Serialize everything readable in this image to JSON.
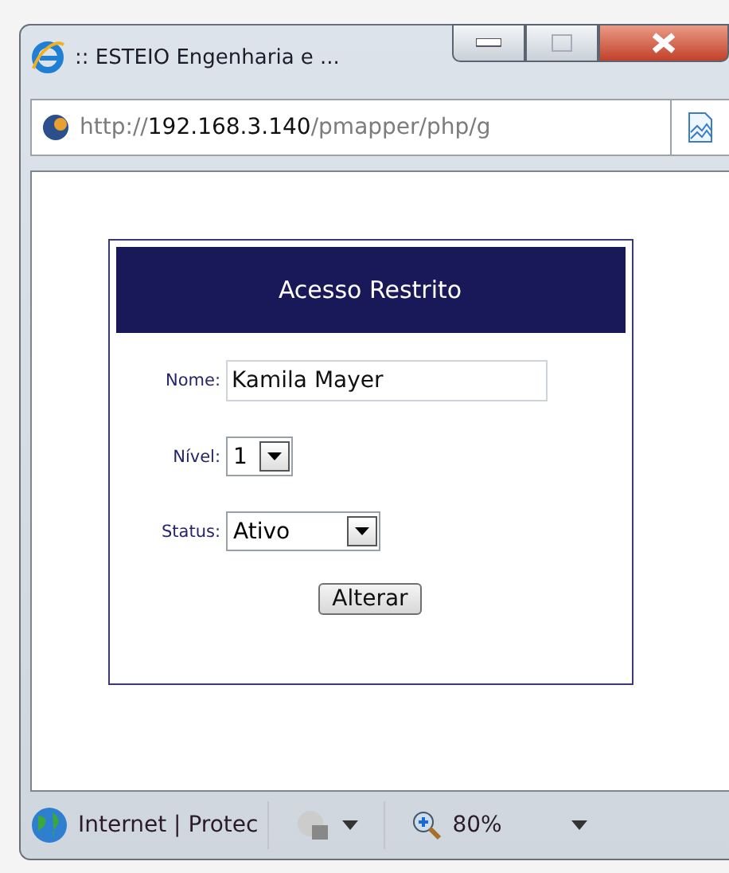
{
  "window": {
    "title": ":: ESTEIO Engenharia e ..."
  },
  "address_bar": {
    "url_scheme": "http://",
    "url_host": "192.168.3.140",
    "url_path": "/pmapper/php/g"
  },
  "form": {
    "title": "Acesso Restrito",
    "fields": [
      {
        "kind": "text",
        "label": "Nome:",
        "value": "Kamila Mayer"
      },
      {
        "kind": "select",
        "label": "Nível:",
        "value": "1"
      },
      {
        "kind": "select",
        "label": "Status:",
        "value": "Ativo"
      }
    ],
    "button": "Alterar"
  },
  "status_bar": {
    "zone": "Internet | Protec",
    "zoom": "80%"
  }
}
